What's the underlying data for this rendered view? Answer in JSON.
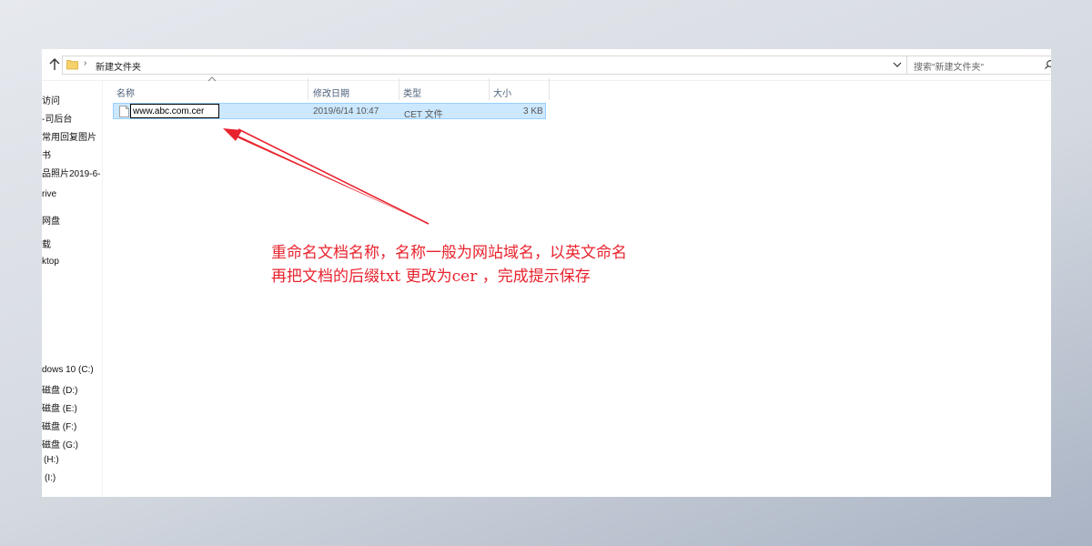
{
  "address_bar": {
    "separator": "›",
    "path": "新建文件夹",
    "search_placeholder": "搜索\"新建文件夹\""
  },
  "nav_pane": {
    "items": [
      "访问",
      "-司后台",
      "常用回复图片",
      "书",
      "品照片2019-6-",
      "rive",
      "网盘",
      "载",
      "ktop",
      "dows 10 (C:)",
      "磁盘 (D:)",
      "磁盘 (E:)",
      "磁盘 (F:)",
      "磁盘 (G:)",
      "(H:)",
      "(I:)"
    ]
  },
  "columns": {
    "name": "名称",
    "date": "修改日期",
    "type": "类型",
    "size": "大小"
  },
  "file": {
    "name_editing": "www.abc.com.cer",
    "date": "2019/6/14 10:47",
    "type": "CET 文件",
    "size": "3 KB"
  },
  "annotation": {
    "line1": "重命名文档名称，名称一般为网站域名，以英文命名",
    "line2": "再把文档的后缀txt 更改为cer ，完成提示保存",
    "color": "#e8232e"
  }
}
